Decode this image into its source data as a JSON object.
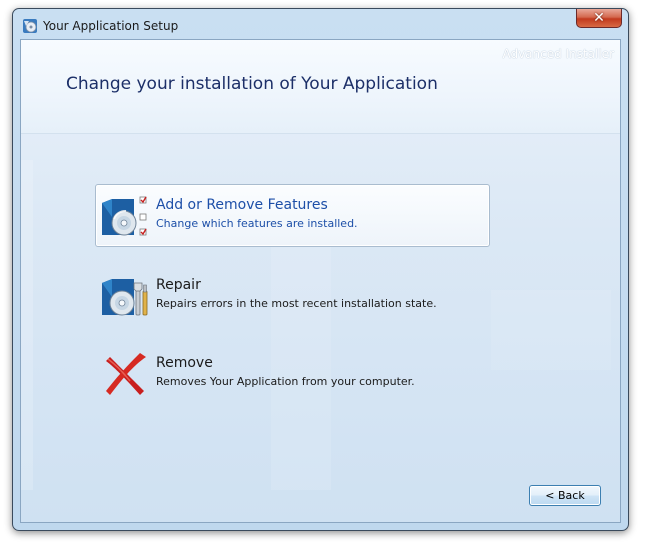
{
  "window": {
    "title": "Your Application Setup",
    "close_label": "✕"
  },
  "header": {
    "brand": "Advanced Installer",
    "title": "Change your installation of Your Application"
  },
  "options": [
    {
      "title": "Add or Remove Features",
      "description": "Change which features are installed.",
      "icon": "add-remove-features-icon",
      "selected": true
    },
    {
      "title": "Repair",
      "description": "Repairs errors in the most recent installation state.",
      "icon": "repair-icon",
      "selected": false
    },
    {
      "title": "Remove",
      "description": "Removes Your Application from your computer.",
      "icon": "remove-x-icon",
      "selected": false
    }
  ],
  "footer": {
    "back_label": "< Back"
  },
  "colors": {
    "title_color": "#1c2f68",
    "selected_text": "#1d4fa8",
    "remove_red": "#c81e1e"
  }
}
